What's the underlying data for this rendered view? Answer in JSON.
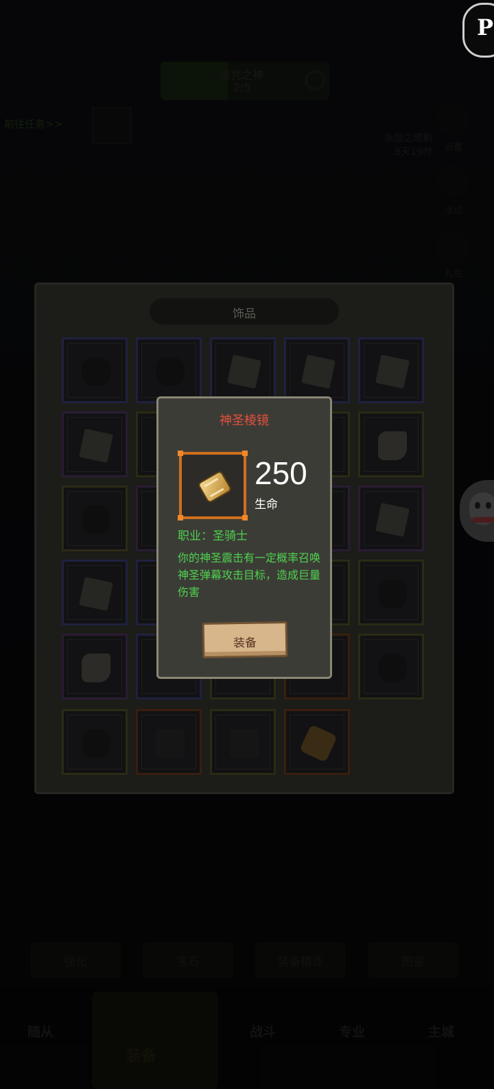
{
  "background": {
    "top_card": {
      "title": "诅咒之神",
      "progress": "2/5"
    },
    "left_link": "前往任务>>",
    "right_info": [
      "永恒之塔剩",
      "8天19时"
    ],
    "right_labels": [
      "设置",
      "活动",
      "礼包"
    ],
    "sub_tabs": [
      "强化",
      "宝石",
      "装备精炼",
      "图鉴"
    ],
    "nav_items": [
      "随从",
      "装备",
      "战斗",
      "专业",
      "主城"
    ]
  },
  "panel": {
    "title": "饰品"
  },
  "modal": {
    "item_name": "神圣棱镜",
    "stat_value": "250",
    "stat_label": "生命",
    "class_text": "职业：圣骑士",
    "description": "你的神圣震击有一定概率召唤神圣弹幕攻击目标，造成巨量伤害",
    "equip_label": "装备"
  },
  "colors": {
    "title_red": "#e1503b",
    "desc_green": "#4ed24e",
    "frame_orange": "#cf6f1e"
  },
  "icons": {
    "overlay_logo": "p-logo-icon",
    "side_bubble": "penguin-icon"
  }
}
